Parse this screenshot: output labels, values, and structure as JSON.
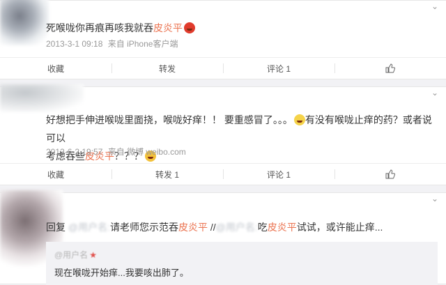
{
  "posts": [
    {
      "text_parts": [
        "死喉咙你再痕再咳我就吞",
        "皮炎平"
      ],
      "meta_time": "2013-3-1 09:18",
      "meta_source": "来自 iPhone客户端",
      "actions": {
        "favorite": "收藏",
        "repost": "转发",
        "comment": "评论 1"
      }
    },
    {
      "line1_parts": [
        "好想把手伸进喉咙里面挠，喉咙好痒！！ 要重感冒了。。。",
        "有没有喉咙止痒的药？或者说可以"
      ],
      "line2_parts": [
        "考虑吞些",
        "皮炎平",
        "？？？"
      ],
      "meta_time": "2012-6-2 19:57",
      "meta_source": "来自 微博 weibo.com",
      "actions": {
        "favorite": "收藏",
        "repost": "转发 1",
        "comment": "评论 1"
      }
    },
    {
      "parts": [
        "回复",
        "请老师您示范吞",
        "皮炎平",
        "//",
        "吃",
        "皮炎平",
        "试试，或许能止痒..."
      ],
      "repost_user": "@用户名",
      "repost_text": "现在喉咙开始痒...我要咳出肺了。"
    }
  ]
}
